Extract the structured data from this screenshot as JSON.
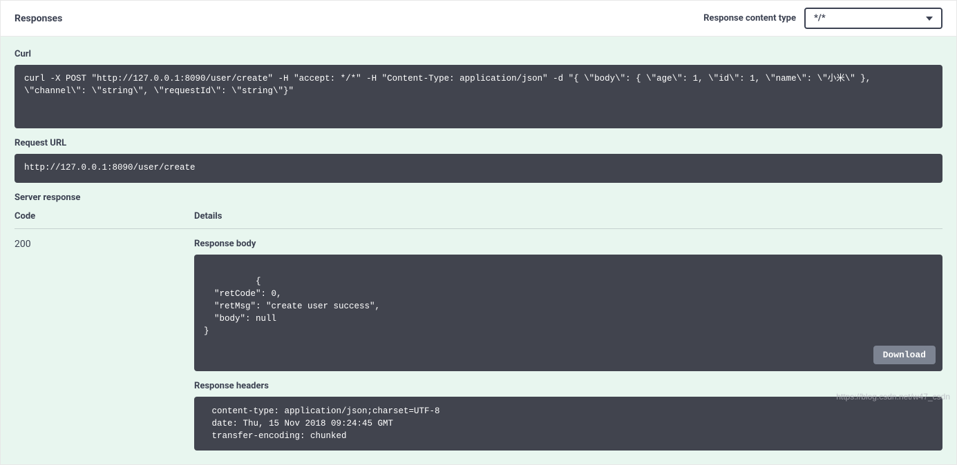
{
  "header": {
    "title": "Responses",
    "content_type_label": "Response content type",
    "content_type_value": "*/*"
  },
  "curl": {
    "label": "Curl",
    "command": "curl -X POST \"http://127.0.0.1:8090/user/create\" -H \"accept: */*\" -H \"Content-Type: application/json\" -d \"{ \\\"body\\\": { \\\"age\\\": 1, \\\"id\\\": 1, \\\"name\\\": \\\"小米\\\" }, \\\"channel\\\": \\\"string\\\", \\\"requestId\\\": \\\"string\\\"}\""
  },
  "request_url": {
    "label": "Request URL",
    "value": "http://127.0.0.1:8090/user/create"
  },
  "server_response": {
    "label": "Server response",
    "columns": {
      "code": "Code",
      "details": "Details"
    },
    "code": "200",
    "response_body": {
      "label": "Response body",
      "content": "{\n  \"retCode\": 0,\n  \"retMsg\": \"create user success\",\n  \"body\": null\n}"
    },
    "download_label": "Download",
    "response_headers": {
      "label": "Response headers",
      "content": " content-type: application/json;charset=UTF-8 \n date: Thu, 15 Nov 2018 09:24:45 GMT \n transfer-encoding: chunked "
    }
  },
  "watermark": "https://blog.csdn.net/w47_csdn"
}
